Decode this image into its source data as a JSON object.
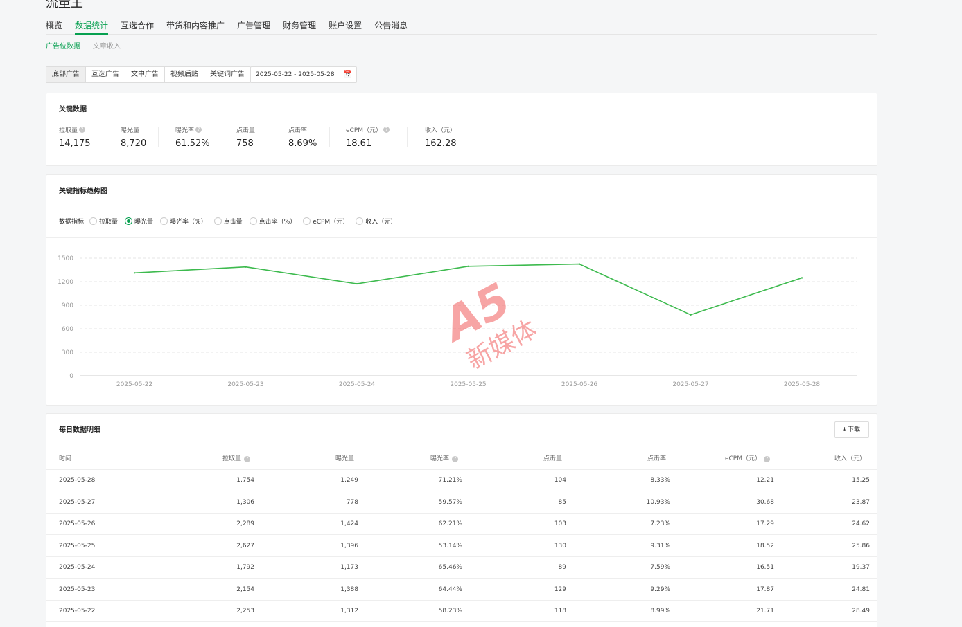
{
  "app_title": "流量主",
  "nav": [
    "概览",
    "数据统计",
    "互选合作",
    "带货和内容推广",
    "广告管理",
    "财务管理",
    "账户设置",
    "公告消息"
  ],
  "nav_active": 1,
  "subnav": [
    "广告位数据",
    "文章收入"
  ],
  "ad_types": [
    "底部广告",
    "互选广告",
    "文中广告",
    "视频后贴",
    "关键词广告"
  ],
  "date_range": "2025-05-22 - 2025-05-28",
  "key_data": {
    "title": "关键数据",
    "items": [
      {
        "label": "拉取量",
        "value": "14,175",
        "help": true
      },
      {
        "label": "曝光量",
        "value": "8,720",
        "help": false
      },
      {
        "label": "曝光率",
        "value": "61.52%",
        "help": true
      },
      {
        "label": "点击量",
        "value": "758",
        "help": false
      },
      {
        "label": "点击率",
        "value": "8.69%",
        "help": false
      },
      {
        "label": "eCPM（元）",
        "value": "18.61",
        "help": true
      },
      {
        "label": "收入（元）",
        "value": "162.28",
        "help": false
      }
    ]
  },
  "trend": {
    "title": "关键指标趋势图",
    "metric_label": "数据指标",
    "metrics": [
      "拉取量",
      "曝光量",
      "曝光率（%）",
      "点击量",
      "点击率（%）",
      "eCPM（元）",
      "收入（元）"
    ],
    "selected_metric": 1
  },
  "chart_data": {
    "type": "line",
    "categories": [
      "2025-05-22",
      "2025-05-23",
      "2025-05-24",
      "2025-05-25",
      "2025-05-26",
      "2025-05-27",
      "2025-05-28"
    ],
    "series": [
      {
        "values": [
          1312,
          1388,
          1173,
          1396,
          1424,
          778,
          1249
        ]
      }
    ],
    "yticks": [
      0,
      300,
      600,
      900,
      1200,
      1500
    ],
    "ylim": [
      0,
      1500
    ],
    "grid": true,
    "line_color": "#3dba4e"
  },
  "daily": {
    "title": "每日数据明细",
    "download_label": "下载",
    "columns": [
      {
        "label": "时间",
        "help": false
      },
      {
        "label": "拉取量",
        "help": true
      },
      {
        "label": "曝光量",
        "help": false
      },
      {
        "label": "曝光率",
        "help": true
      },
      {
        "label": "点击量",
        "help": false
      },
      {
        "label": "点击率",
        "help": false
      },
      {
        "label": "eCPM（元）",
        "help": true
      },
      {
        "label": "收入（元）",
        "help": false
      }
    ],
    "rows": [
      [
        "2025-05-28",
        "1,754",
        "1,249",
        "71.21%",
        "104",
        "8.33%",
        "12.21",
        "15.25"
      ],
      [
        "2025-05-27",
        "1,306",
        "778",
        "59.57%",
        "85",
        "10.93%",
        "30.68",
        "23.87"
      ],
      [
        "2025-05-26",
        "2,289",
        "1,424",
        "62.21%",
        "103",
        "7.23%",
        "17.29",
        "24.62"
      ],
      [
        "2025-05-25",
        "2,627",
        "1,396",
        "53.14%",
        "130",
        "9.31%",
        "18.52",
        "25.86"
      ],
      [
        "2025-05-24",
        "1,792",
        "1,173",
        "65.46%",
        "89",
        "7.59%",
        "16.51",
        "19.37"
      ],
      [
        "2025-05-23",
        "2,154",
        "1,388",
        "64.44%",
        "129",
        "9.29%",
        "17.87",
        "24.81"
      ],
      [
        "2025-05-22",
        "2,253",
        "1,312",
        "58.23%",
        "118",
        "8.99%",
        "21.71",
        "28.49"
      ]
    ]
  },
  "watermark": {
    "logo": "A5",
    "text": "新媒体"
  }
}
